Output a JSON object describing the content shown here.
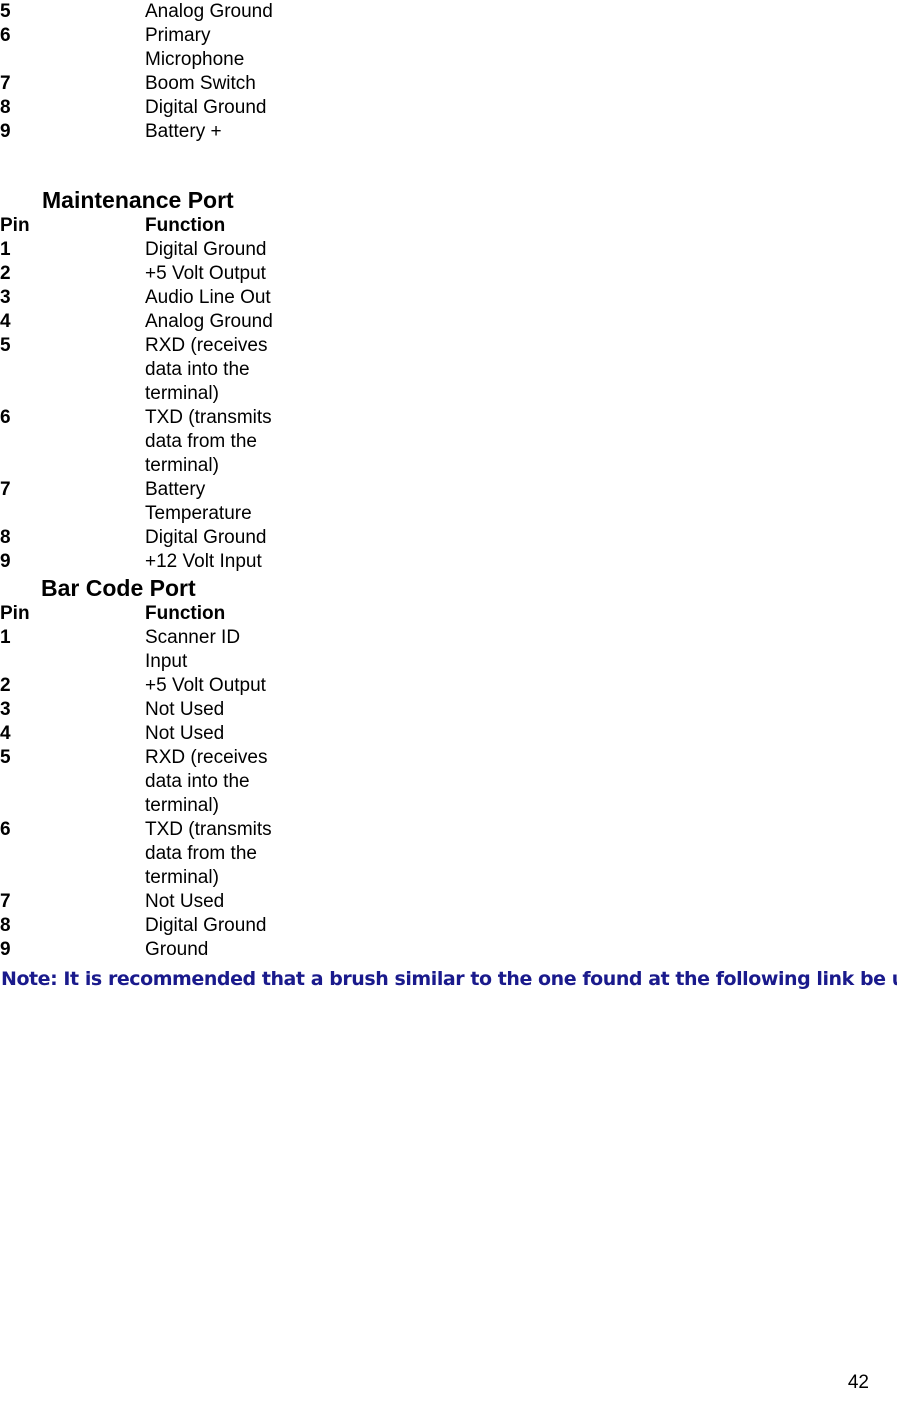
{
  "document": {
    "page_number": "42"
  },
  "continued_table": {
    "rows": [
      {
        "pin": "5",
        "function": "Analog Ground"
      },
      {
        "pin": "6",
        "function": "Primary Microphone"
      },
      {
        "pin": "7",
        "function": "Boom Switch"
      },
      {
        "pin": "8",
        "function": "Digital Ground"
      },
      {
        "pin": "9",
        "function": "Battery +"
      }
    ]
  },
  "maintenance_port": {
    "heading": "Maintenance Port",
    "columns": {
      "pin": "Pin",
      "function": "Function"
    },
    "rows": [
      {
        "pin": "1",
        "function": "Digital Ground"
      },
      {
        "pin": "2",
        "function": "+5 Volt Output"
      },
      {
        "pin": "3",
        "function": "Audio Line Out"
      },
      {
        "pin": "4",
        "function": "Analog Ground"
      },
      {
        "pin": "5",
        "function": "RXD (receives data into the terminal)"
      },
      {
        "pin": "6",
        "function": "TXD (transmits data from the terminal)"
      },
      {
        "pin": "7",
        "function": "Battery Temperature"
      },
      {
        "pin": "8",
        "function": "Digital Ground"
      },
      {
        "pin": "9",
        "function": "+12 Volt Input"
      }
    ]
  },
  "bar_code_port": {
    "heading": "Bar Code Port",
    "columns": {
      "pin": "Pin",
      "function": "Function"
    },
    "rows": [
      {
        "pin": "1",
        "function": "Scanner ID Input"
      },
      {
        "pin": "2",
        "function": "+5 Volt Output"
      },
      {
        "pin": "3",
        "function": "Not Used"
      },
      {
        "pin": "4",
        "function": "Not Used"
      },
      {
        "pin": "5",
        "function": "RXD (receives data into the terminal)"
      },
      {
        "pin": "6",
        "function": "TXD (transmits data from the terminal)"
      },
      {
        "pin": "7",
        "function": "Not Used"
      },
      {
        "pin": "8",
        "function": "Digital Ground"
      },
      {
        "pin": "9",
        "function": "Ground"
      }
    ]
  },
  "note": {
    "text": "Note: It is recommended that a brush similar to the one found at the following link be used",
    "color": "#1a1a8c"
  }
}
